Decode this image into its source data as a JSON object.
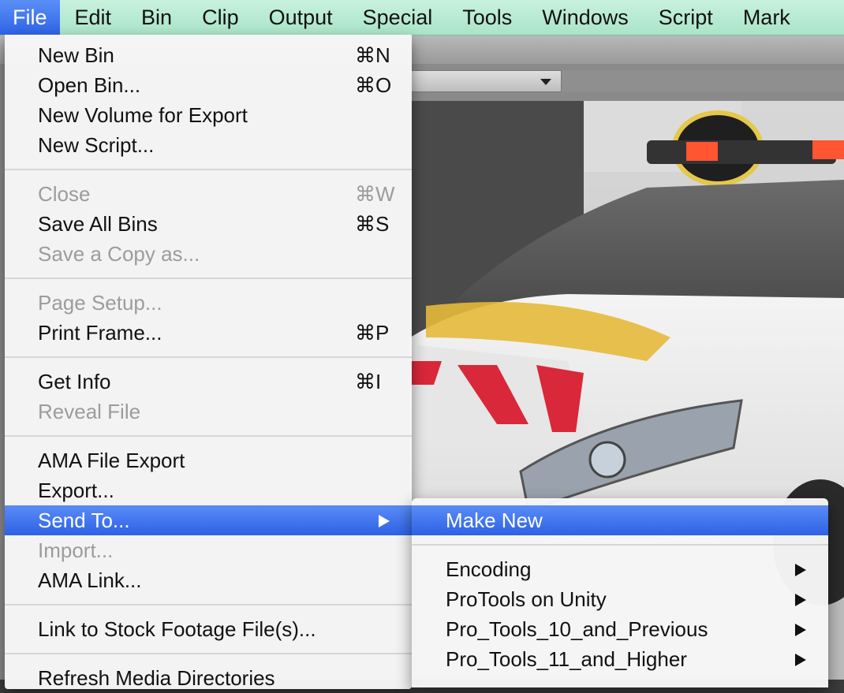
{
  "menubar": {
    "items": [
      "File",
      "Edit",
      "Bin",
      "Clip",
      "Output",
      "Special",
      "Tools",
      "Windows",
      "Script",
      "Mark"
    ],
    "active": "File"
  },
  "file_menu": {
    "items": [
      {
        "label": "New Bin",
        "shortcut": "⌘N",
        "enabled": true
      },
      {
        "label": "Open Bin...",
        "shortcut": "⌘O",
        "enabled": true
      },
      {
        "label": "New Volume for Export",
        "shortcut": "",
        "enabled": true
      },
      {
        "label": "New Script...",
        "shortcut": "",
        "enabled": true
      },
      {
        "label": "Close",
        "shortcut": "⌘W",
        "enabled": false
      },
      {
        "label": "Save All Bins",
        "shortcut": "⌘S",
        "enabled": true
      },
      {
        "label": "Save a Copy as...",
        "shortcut": "",
        "enabled": false
      },
      {
        "label": "Page Setup...",
        "shortcut": "",
        "enabled": false
      },
      {
        "label": "Print Frame...",
        "shortcut": "⌘P",
        "enabled": true
      },
      {
        "label": "Get Info",
        "shortcut": "⌘I",
        "enabled": true
      },
      {
        "label": "Reveal File",
        "shortcut": "",
        "enabled": false
      },
      {
        "label": "AMA File Export",
        "shortcut": "",
        "enabled": true
      },
      {
        "label": "Export...",
        "shortcut": "",
        "enabled": true
      },
      {
        "label": "Send To...",
        "shortcut": "",
        "enabled": true,
        "highlighted": true,
        "submenu": true
      },
      {
        "label": "Import...",
        "shortcut": "",
        "enabled": false
      },
      {
        "label": "AMA Link...",
        "shortcut": "",
        "enabled": true
      },
      {
        "label": "Link to Stock Footage File(s)...",
        "shortcut": "",
        "enabled": true
      },
      {
        "label": "Refresh Media Directories",
        "shortcut": "",
        "enabled": true
      }
    ]
  },
  "send_to_submenu": {
    "items": [
      {
        "label": "Make New",
        "highlighted": true,
        "submenu": false
      },
      {
        "label": "Encoding",
        "submenu": true
      },
      {
        "label": "ProTools on Unity",
        "submenu": true
      },
      {
        "label": "Pro_Tools_10_and_Previous",
        "submenu": true
      },
      {
        "label": "Pro_Tools_11_and_Higher",
        "submenu": true
      }
    ]
  },
  "colors": {
    "menubar_bg": "#b8ead2",
    "highlight": "#3a6fe9",
    "disabled_text": "#9c9c9c"
  }
}
